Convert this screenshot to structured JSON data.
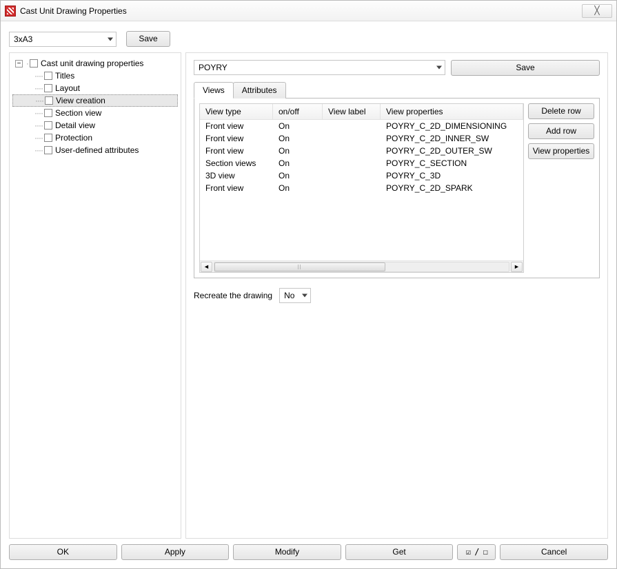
{
  "window": {
    "title": "Cast Unit Drawing Properties",
    "close_glyph": "╳"
  },
  "top": {
    "preset": "3xA3",
    "save_label": "Save"
  },
  "tree": {
    "root": "Cast unit drawing properties",
    "items": [
      {
        "label": "Titles"
      },
      {
        "label": "Layout"
      },
      {
        "label": "View creation",
        "selected": true
      },
      {
        "label": "Section view"
      },
      {
        "label": "Detail view"
      },
      {
        "label": "Protection"
      },
      {
        "label": "User-defined attributes"
      }
    ]
  },
  "right": {
    "preset": "POYRY",
    "save_label": "Save",
    "tabs": {
      "views": "Views",
      "attributes": "Attributes",
      "active": "views"
    },
    "columns": {
      "type": "View type",
      "onoff": "on/off",
      "label": "View label",
      "props": "View properties"
    },
    "rows": [
      {
        "type": "Front view",
        "onoff": "On",
        "label": "",
        "props": "POYRY_C_2D_DIMENSIONING"
      },
      {
        "type": "Front view",
        "onoff": "On",
        "label": "",
        "props": "POYRY_C_2D_INNER_SW"
      },
      {
        "type": "Front view",
        "onoff": "On",
        "label": "",
        "props": "POYRY_C_2D_OUTER_SW"
      },
      {
        "type": "Section views",
        "onoff": "On",
        "label": "",
        "props": "POYRY_C_SECTION"
      },
      {
        "type": "3D view",
        "onoff": "On",
        "label": "",
        "props": "POYRY_C_3D"
      },
      {
        "type": "Front view",
        "onoff": "On",
        "label": "",
        "props": "POYRY_C_2D_SPARK"
      }
    ],
    "buttons": {
      "delete": "Delete row",
      "add": "Add row",
      "viewprops": "View properties"
    },
    "recreate_label": "Recreate the drawing",
    "recreate_value": "No"
  },
  "footer": {
    "ok": "OK",
    "apply": "Apply",
    "modify": "Modify",
    "get": "Get",
    "toggle": "☑ / ☐",
    "cancel": "Cancel"
  }
}
